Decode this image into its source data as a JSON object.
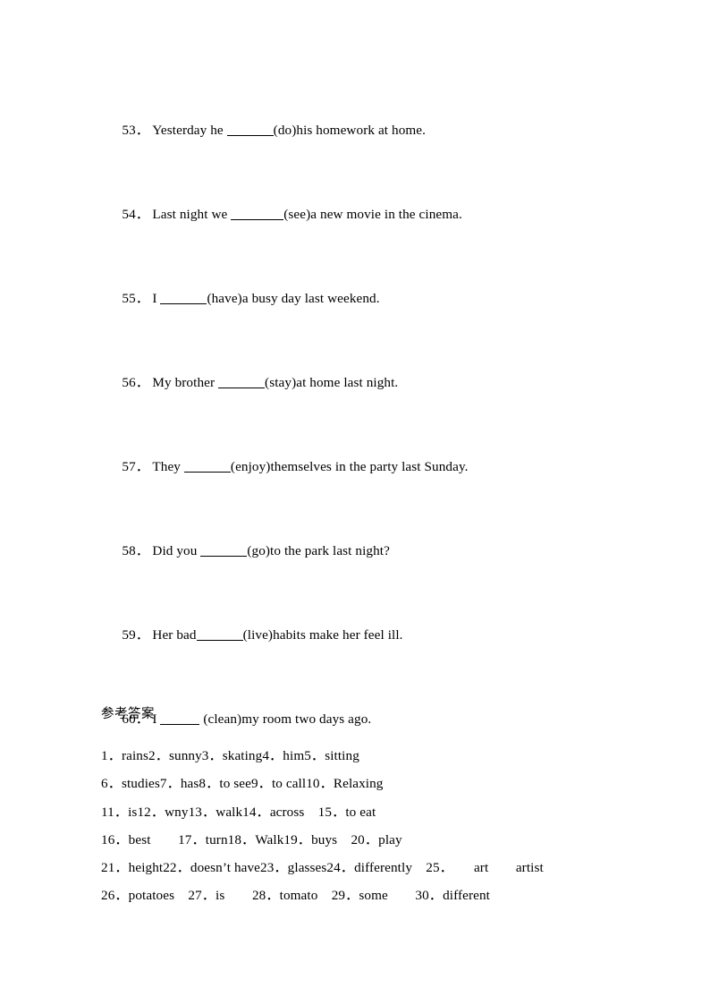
{
  "document": {
    "background_color": "#ffffff",
    "text_color": "#000000"
  },
  "exercise": {
    "items": [
      {
        "number": "53．",
        "before": "Yesterday he ",
        "blank": "______",
        "after": "(do)his homework at home."
      },
      {
        "number": "54．",
        "before": "Last night we ",
        "blank": "_______",
        "after": "(see)a new movie in the cinema."
      },
      {
        "number": "55．",
        "before": "I ",
        "blank": "______",
        "after": "(have)a busy day last weekend."
      },
      {
        "number": "56．",
        "before": "My brother ",
        "blank": "______",
        "after": "(stay)at home last night."
      },
      {
        "number": "57．",
        "before": "They ",
        "blank": "______",
        "after": "(enjoy)themselves in the party last Sunday."
      },
      {
        "number": "58．",
        "before": "Did you ",
        "blank": "______",
        "after": "(go)to the park last night?"
      },
      {
        "number": "59．",
        "before": "Her bad",
        "blank": "______",
        "after": "(live)habits make her feel ill."
      },
      {
        "number": "60．",
        "before": "I ",
        "blank": "_____",
        "after": " (clean)my room two days ago."
      }
    ],
    "lines_plain": [
      "53．  Yesterday he ______(do)his homework at home.",
      "54．  Last night we _______(see)a new movie in the cinema.",
      "55．  I ______(have)a busy day last weekend.",
      "56．  My brother ______(stay)at home last night.",
      "57．  They ______(enjoy)themselves in the party last Sunday.",
      "58．  Did you ______(go)to the park last night?",
      "59．  Her bad______(live)habits make her feel ill.",
      "60．  I _____ (clean)my room two days ago."
    ]
  },
  "answers": {
    "heading": "参考答案",
    "lines": [
      "1．rains2．sunny3．skating4．him5．sitting",
      "6．studies7．has8．to see9．to call10．Relaxing",
      "11．is12．wny13．walk14．across　15．to eat",
      "16．best　　17．turn18．Walk19．buys　20．play",
      "21．height22．doesn’t have23．glasses24．differently　25．　　art　　artist",
      "26．potatoes　27．is　　28．tomato　29．some　　30．different"
    ],
    "entries": [
      {
        "number": "1",
        "value": "rains"
      },
      {
        "number": "2",
        "value": "sunny"
      },
      {
        "number": "3",
        "value": "skating"
      },
      {
        "number": "4",
        "value": "him"
      },
      {
        "number": "5",
        "value": "sitting"
      },
      {
        "number": "6",
        "value": "studies"
      },
      {
        "number": "7",
        "value": "has"
      },
      {
        "number": "8",
        "value": "to see"
      },
      {
        "number": "9",
        "value": "to call"
      },
      {
        "number": "10",
        "value": "Relaxing"
      },
      {
        "number": "11",
        "value": "is"
      },
      {
        "number": "12",
        "value": "wny"
      },
      {
        "number": "13",
        "value": "walk"
      },
      {
        "number": "14",
        "value": "across"
      },
      {
        "number": "15",
        "value": "to eat"
      },
      {
        "number": "16",
        "value": "best"
      },
      {
        "number": "17",
        "value": "turn"
      },
      {
        "number": "18",
        "value": "Walk"
      },
      {
        "number": "19",
        "value": "buys"
      },
      {
        "number": "20",
        "value": "play"
      },
      {
        "number": "21",
        "value": "height"
      },
      {
        "number": "22",
        "value": "doesn’t have"
      },
      {
        "number": "23",
        "value": "glasses"
      },
      {
        "number": "24",
        "value": "differently"
      },
      {
        "number": "25",
        "value": "art    artist"
      },
      {
        "number": "26",
        "value": "potatoes"
      },
      {
        "number": "27",
        "value": "is"
      },
      {
        "number": "28",
        "value": "tomato"
      },
      {
        "number": "29",
        "value": "some"
      },
      {
        "number": "30",
        "value": "different"
      }
    ]
  }
}
